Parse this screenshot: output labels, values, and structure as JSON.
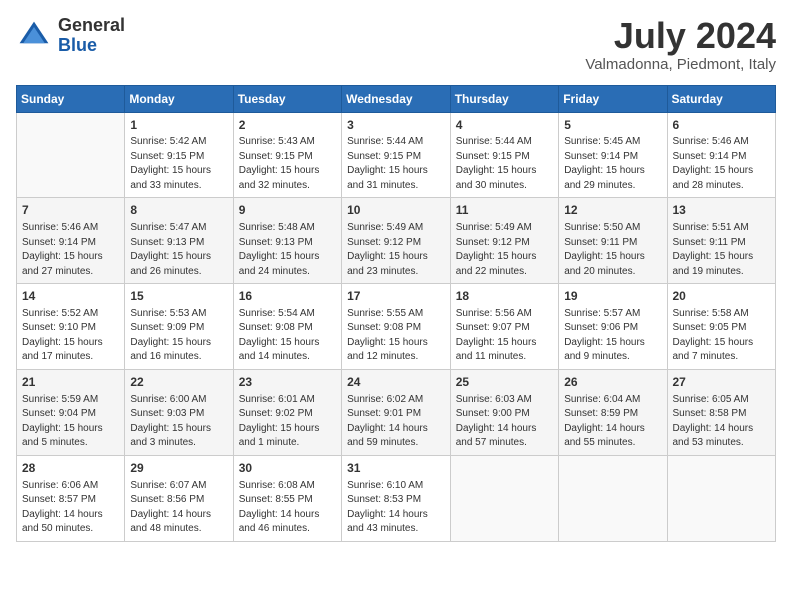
{
  "header": {
    "logo_line1": "General",
    "logo_line2": "Blue",
    "month": "July 2024",
    "location": "Valmadonna, Piedmont, Italy"
  },
  "days_of_week": [
    "Sunday",
    "Monday",
    "Tuesday",
    "Wednesday",
    "Thursday",
    "Friday",
    "Saturday"
  ],
  "weeks": [
    [
      {
        "day": "",
        "info": ""
      },
      {
        "day": "1",
        "info": "Sunrise: 5:42 AM\nSunset: 9:15 PM\nDaylight: 15 hours\nand 33 minutes."
      },
      {
        "day": "2",
        "info": "Sunrise: 5:43 AM\nSunset: 9:15 PM\nDaylight: 15 hours\nand 32 minutes."
      },
      {
        "day": "3",
        "info": "Sunrise: 5:44 AM\nSunset: 9:15 PM\nDaylight: 15 hours\nand 31 minutes."
      },
      {
        "day": "4",
        "info": "Sunrise: 5:44 AM\nSunset: 9:15 PM\nDaylight: 15 hours\nand 30 minutes."
      },
      {
        "day": "5",
        "info": "Sunrise: 5:45 AM\nSunset: 9:14 PM\nDaylight: 15 hours\nand 29 minutes."
      },
      {
        "day": "6",
        "info": "Sunrise: 5:46 AM\nSunset: 9:14 PM\nDaylight: 15 hours\nand 28 minutes."
      }
    ],
    [
      {
        "day": "7",
        "info": "Sunrise: 5:46 AM\nSunset: 9:14 PM\nDaylight: 15 hours\nand 27 minutes."
      },
      {
        "day": "8",
        "info": "Sunrise: 5:47 AM\nSunset: 9:13 PM\nDaylight: 15 hours\nand 26 minutes."
      },
      {
        "day": "9",
        "info": "Sunrise: 5:48 AM\nSunset: 9:13 PM\nDaylight: 15 hours\nand 24 minutes."
      },
      {
        "day": "10",
        "info": "Sunrise: 5:49 AM\nSunset: 9:12 PM\nDaylight: 15 hours\nand 23 minutes."
      },
      {
        "day": "11",
        "info": "Sunrise: 5:49 AM\nSunset: 9:12 PM\nDaylight: 15 hours\nand 22 minutes."
      },
      {
        "day": "12",
        "info": "Sunrise: 5:50 AM\nSunset: 9:11 PM\nDaylight: 15 hours\nand 20 minutes."
      },
      {
        "day": "13",
        "info": "Sunrise: 5:51 AM\nSunset: 9:11 PM\nDaylight: 15 hours\nand 19 minutes."
      }
    ],
    [
      {
        "day": "14",
        "info": "Sunrise: 5:52 AM\nSunset: 9:10 PM\nDaylight: 15 hours\nand 17 minutes."
      },
      {
        "day": "15",
        "info": "Sunrise: 5:53 AM\nSunset: 9:09 PM\nDaylight: 15 hours\nand 16 minutes."
      },
      {
        "day": "16",
        "info": "Sunrise: 5:54 AM\nSunset: 9:08 PM\nDaylight: 15 hours\nand 14 minutes."
      },
      {
        "day": "17",
        "info": "Sunrise: 5:55 AM\nSunset: 9:08 PM\nDaylight: 15 hours\nand 12 minutes."
      },
      {
        "day": "18",
        "info": "Sunrise: 5:56 AM\nSunset: 9:07 PM\nDaylight: 15 hours\nand 11 minutes."
      },
      {
        "day": "19",
        "info": "Sunrise: 5:57 AM\nSunset: 9:06 PM\nDaylight: 15 hours\nand 9 minutes."
      },
      {
        "day": "20",
        "info": "Sunrise: 5:58 AM\nSunset: 9:05 PM\nDaylight: 15 hours\nand 7 minutes."
      }
    ],
    [
      {
        "day": "21",
        "info": "Sunrise: 5:59 AM\nSunset: 9:04 PM\nDaylight: 15 hours\nand 5 minutes."
      },
      {
        "day": "22",
        "info": "Sunrise: 6:00 AM\nSunset: 9:03 PM\nDaylight: 15 hours\nand 3 minutes."
      },
      {
        "day": "23",
        "info": "Sunrise: 6:01 AM\nSunset: 9:02 PM\nDaylight: 15 hours\nand 1 minute."
      },
      {
        "day": "24",
        "info": "Sunrise: 6:02 AM\nSunset: 9:01 PM\nDaylight: 14 hours\nand 59 minutes."
      },
      {
        "day": "25",
        "info": "Sunrise: 6:03 AM\nSunset: 9:00 PM\nDaylight: 14 hours\nand 57 minutes."
      },
      {
        "day": "26",
        "info": "Sunrise: 6:04 AM\nSunset: 8:59 PM\nDaylight: 14 hours\nand 55 minutes."
      },
      {
        "day": "27",
        "info": "Sunrise: 6:05 AM\nSunset: 8:58 PM\nDaylight: 14 hours\nand 53 minutes."
      }
    ],
    [
      {
        "day": "28",
        "info": "Sunrise: 6:06 AM\nSunset: 8:57 PM\nDaylight: 14 hours\nand 50 minutes."
      },
      {
        "day": "29",
        "info": "Sunrise: 6:07 AM\nSunset: 8:56 PM\nDaylight: 14 hours\nand 48 minutes."
      },
      {
        "day": "30",
        "info": "Sunrise: 6:08 AM\nSunset: 8:55 PM\nDaylight: 14 hours\nand 46 minutes."
      },
      {
        "day": "31",
        "info": "Sunrise: 6:10 AM\nSunset: 8:53 PM\nDaylight: 14 hours\nand 43 minutes."
      },
      {
        "day": "",
        "info": ""
      },
      {
        "day": "",
        "info": ""
      },
      {
        "day": "",
        "info": ""
      }
    ]
  ]
}
